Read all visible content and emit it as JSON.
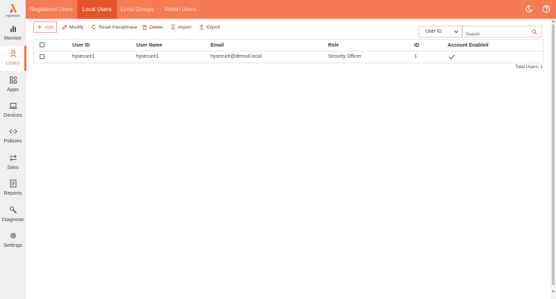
{
  "brand": {
    "logo_text": "HySecure",
    "accent": "#f47b52",
    "accent_dark": "#e3542a"
  },
  "sidebar": {
    "items": [
      {
        "label": "Monitor",
        "icon": "bar-chart-icon"
      },
      {
        "label": "Users",
        "icon": "user-icon",
        "active": true
      },
      {
        "label": "Apps",
        "icon": "apps-grid-icon"
      },
      {
        "label": "Devices",
        "icon": "laptop-icon"
      },
      {
        "label": "Policies",
        "icon": "code-arrows-icon"
      },
      {
        "label": "Sites",
        "icon": "swap-arrows-icon"
      },
      {
        "label": "Reports",
        "icon": "report-icon"
      },
      {
        "label": "Diagnose",
        "icon": "wrench-icon"
      },
      {
        "label": "Settings",
        "icon": "gear-icon"
      }
    ]
  },
  "tabs": [
    {
      "label": "Registered Users"
    },
    {
      "label": "Local Users",
      "active": true
    },
    {
      "label": "Local Groups"
    },
    {
      "label": "Admin Users"
    }
  ],
  "top_icons": {
    "theme": "moon-icon",
    "help": "help-icon"
  },
  "toolbar": {
    "add": "Add",
    "modify": "Modify",
    "reset_passphrase": "Reset Passphrase",
    "delete": "Delete",
    "import": "Import",
    "export": "Export"
  },
  "filter": {
    "selected": "User ID",
    "search_placeholder": "Search"
  },
  "table": {
    "columns": [
      "User ID",
      "User Name",
      "Email",
      "Role",
      "ID",
      "Account Enabled"
    ],
    "rows": [
      {
        "user_id": "hysecure1",
        "user_name": "hysecure1",
        "email": "hysecure@demo4.local",
        "role": "Security Officer",
        "id": "1",
        "account_enabled": true
      }
    ],
    "total_label": "Total Users: 1"
  }
}
